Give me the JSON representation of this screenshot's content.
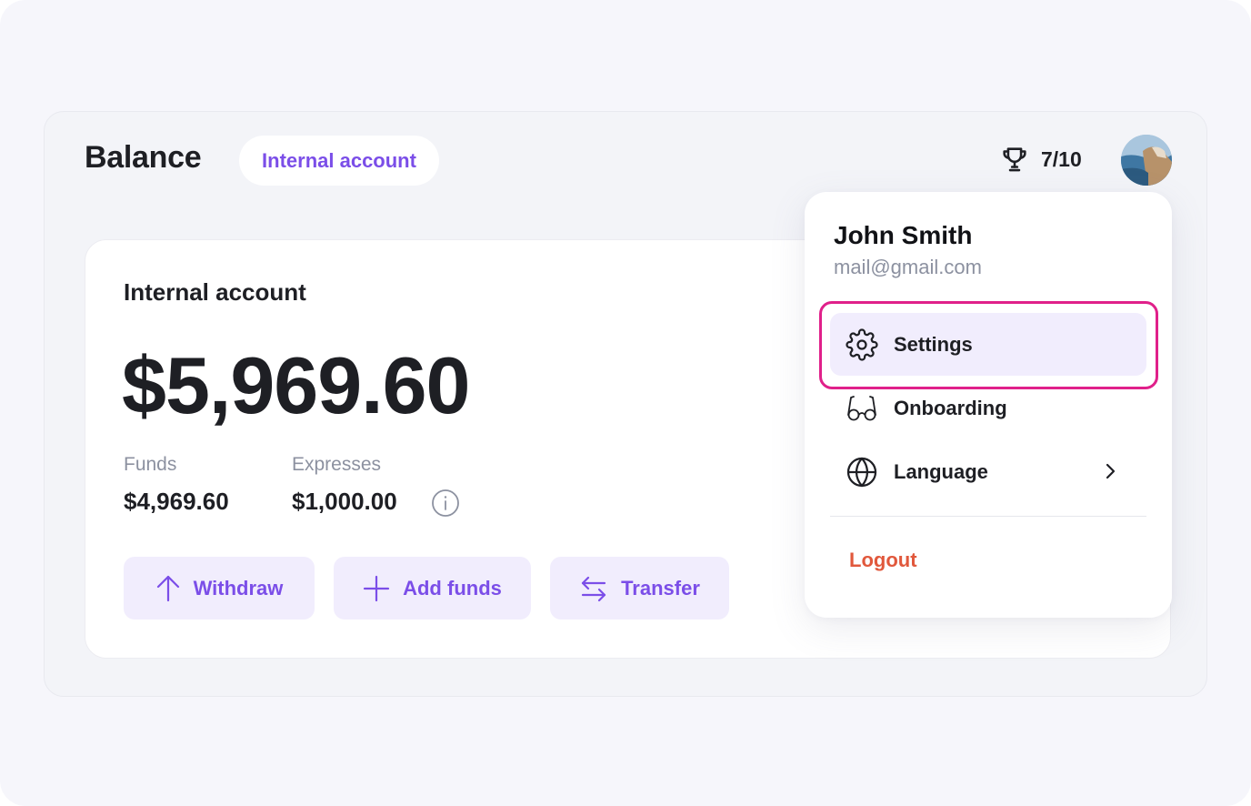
{
  "header": {
    "title": "Balance",
    "account_pill": "Internal account",
    "score": "7/10"
  },
  "card": {
    "title": "Internal account",
    "amount": "$5,969.60",
    "funds_label": "Funds",
    "funds_value": "$4,969.60",
    "expenses_label": "Expresses",
    "expenses_value": "$1,000.00",
    "actions": {
      "withdraw": "Withdraw",
      "add_funds": "Add funds",
      "transfer": "Transfer"
    }
  },
  "menu": {
    "name": "John Smith",
    "email": "mail@gmail.com",
    "items": {
      "settings": "Settings",
      "onboarding": "Onboarding",
      "language": "Language"
    },
    "logout": "Logout"
  },
  "colors": {
    "accent": "#7b4ee8",
    "accent_bg": "#f1edfd",
    "highlight_border": "#e0208a",
    "logout": "#e1583c",
    "muted_text": "#8c91a0"
  }
}
